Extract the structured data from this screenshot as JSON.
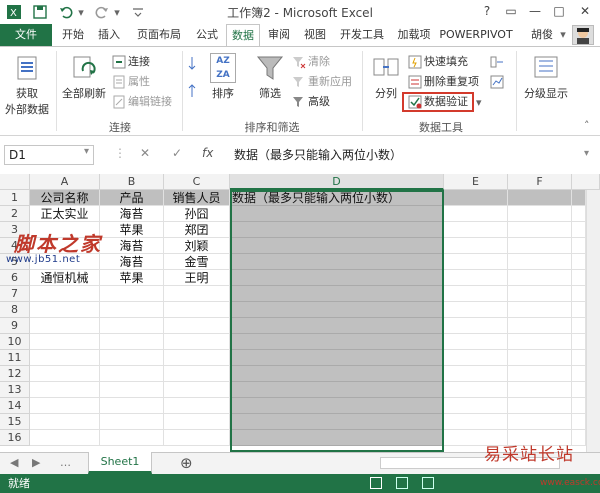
{
  "title_bar": {
    "title": "工作簿2 - Microsoft Excel",
    "help": "?",
    "restore_ribbon": "▭",
    "minimize": "—",
    "maximize": "□",
    "close": "✕"
  },
  "tabs": [
    "文件",
    "开始",
    "插入",
    "页面布局",
    "公式",
    "数据",
    "审阅",
    "视图",
    "开发工具",
    "加载项",
    "POWERPIVOT",
    "胡俊"
  ],
  "active_tab": "数据",
  "ribbon": {
    "get_external_data": [
      "获取",
      "外部数据"
    ],
    "refresh_all": "全部刷新",
    "connections": "连接",
    "properties": "属性",
    "edit_links": "编辑链接",
    "group_connections": "连接",
    "sort_asc": "AZ",
    "sort_desc": "ZA",
    "sort": "排序",
    "filter": "筛选",
    "clear": "清除",
    "reapply": "重新应用",
    "advanced": "高级",
    "group_sort_filter": "排序和筛选",
    "text_to_columns": "分列",
    "flash_fill": "快速填充",
    "remove_duplicates": "删除重复项",
    "data_validation": "数据验证",
    "group_data_tools": "数据工具",
    "outline": "分级显示"
  },
  "formula_bar": {
    "name_box": "D1",
    "cancel": "✕",
    "enter": "✓",
    "fx": "fx",
    "content": "数据（最多只能输入两位小数）"
  },
  "grid": {
    "columns": [
      "A",
      "B",
      "C",
      "D",
      "E",
      "F"
    ],
    "rows": [
      "1",
      "2",
      "3",
      "4",
      "5",
      "6",
      "7",
      "8",
      "9",
      "10",
      "11",
      "12",
      "13",
      "14",
      "15",
      "16"
    ],
    "cells": [
      [
        "公司名称",
        "产品",
        "销售人员",
        "数据（最多只能输入两位小数）"
      ],
      [
        "正太实业",
        "海苔",
        "孙囧",
        ""
      ],
      [
        "",
        "苹果",
        "郑囝",
        ""
      ],
      [
        "",
        "海苔",
        "刘颖",
        ""
      ],
      [
        "",
        "海苔",
        "金雪",
        ""
      ],
      [
        "通恒机械",
        "苹果",
        "王明",
        ""
      ]
    ]
  },
  "sheet_tabs": {
    "active": "Sheet1",
    "add": "⊕"
  },
  "status_bar": {
    "ready": "就绪"
  },
  "watermarks": {
    "left_logo": "脚本之家",
    "left_url": "www.jb51.net",
    "right_logo": "易采站长站",
    "right_url": "www.easck.com"
  },
  "colors": {
    "accent": "#217346",
    "highlight_border": "#d33a2c"
  }
}
